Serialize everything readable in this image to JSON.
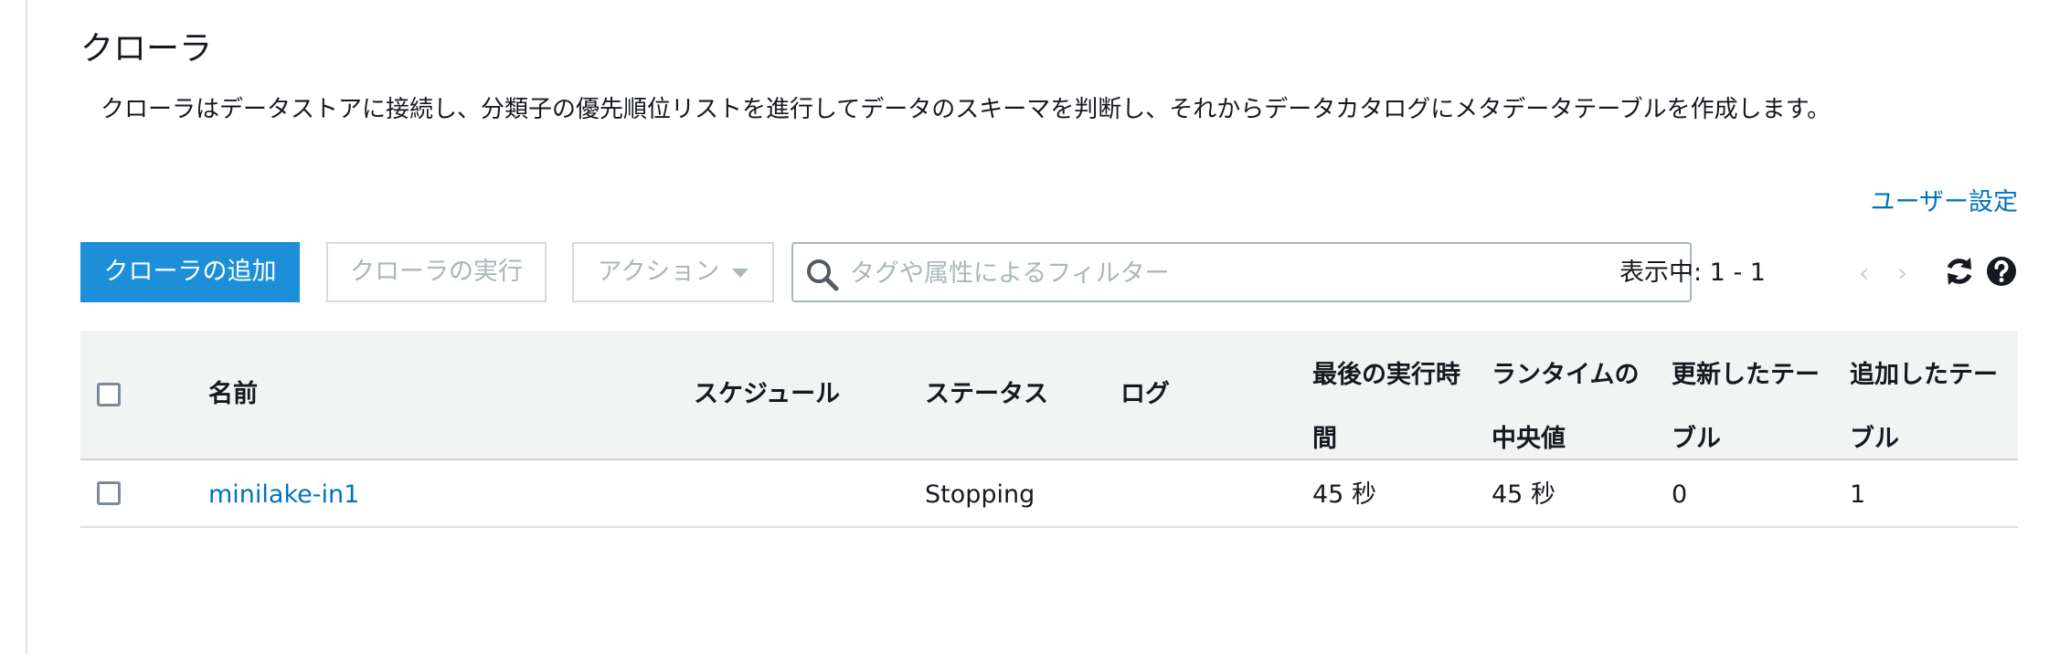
{
  "page": {
    "title": "クローラ",
    "description": "クローラはデータストアに接続し、分類子の優先順位リストを進行してデータのスキーマを判断し、それからデータカタログにメタデータテーブルを作成します。",
    "user_settings": "ユーザー設定"
  },
  "toolbar": {
    "add_crawler": "クローラの追加",
    "run_crawler": "クローラの実行",
    "actions": "アクション",
    "search_placeholder": "タグや属性によるフィルター",
    "pager_text": "表示中: 1 - 1",
    "prev_arrow": "‹",
    "next_arrow": "›"
  },
  "table": {
    "headers": {
      "name": "名前",
      "schedule": "スケジュール",
      "status": "ステータス",
      "log": "ログ",
      "last_runtime": "最後の実行時間",
      "median_runtime": "ランタイムの中央値",
      "tables_updated": "更新したテーブル",
      "tables_added": "追加したテーブル"
    },
    "rows": [
      {
        "name": "minilake-in1",
        "schedule": "",
        "status": "Stopping",
        "log": "",
        "last_runtime": "45 秒",
        "median_runtime": "45 秒",
        "tables_updated": "0",
        "tables_added": "1"
      }
    ]
  },
  "icons": {
    "search": "search-icon",
    "refresh": "refresh-icon",
    "help": "help-icon"
  },
  "colors": {
    "primary": "#1d8fd9",
    "link": "#0073bb",
    "header_bg": "#f2f3f3"
  }
}
